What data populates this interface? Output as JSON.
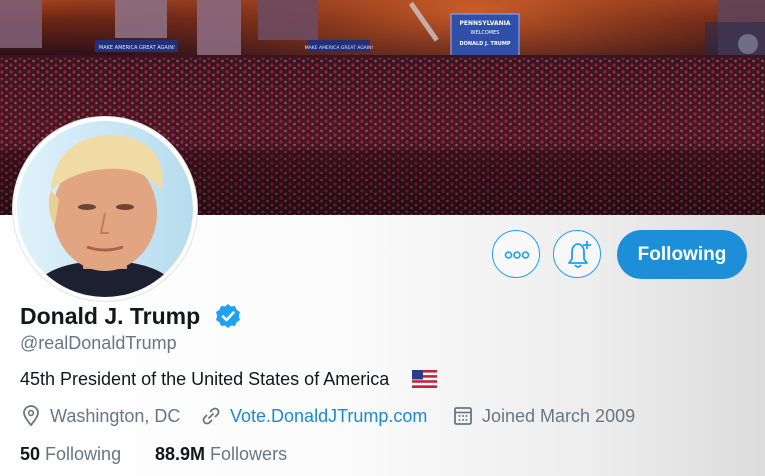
{
  "banner": {
    "signs": [
      "MAKE AMERICA GREAT AGAIN!",
      "MAKE AMERICA GREAT AGAIN!",
      "PENNSYLVANIA",
      "WELCOMES",
      "DONALD J. TRUMP"
    ]
  },
  "profile": {
    "name": "Donald J. Trump",
    "handle": "@realDonaldTrump",
    "bio": "45th President of the United States of America",
    "location": "Washington, DC",
    "website": "Vote.DonaldJTrump.com",
    "joined": "Joined March 2009"
  },
  "actions": {
    "more_label": "•••",
    "following_label": "Following"
  },
  "stats": {
    "following_count": "50",
    "following_label": "Following",
    "followers_count": "88.9M",
    "followers_label": "Followers"
  },
  "icons": {
    "verified": "verified-badge-icon",
    "flag": "us-flag-icon",
    "location": "location-pin-icon",
    "link": "link-icon",
    "calendar": "calendar-icon",
    "bell": "bell-plus-icon"
  },
  "colors": {
    "accent": "#1da1f2",
    "follow_button": "#1d8fd9",
    "text_primary": "#14171a",
    "text_secondary": "#657786",
    "link": "#1b8ad1"
  }
}
